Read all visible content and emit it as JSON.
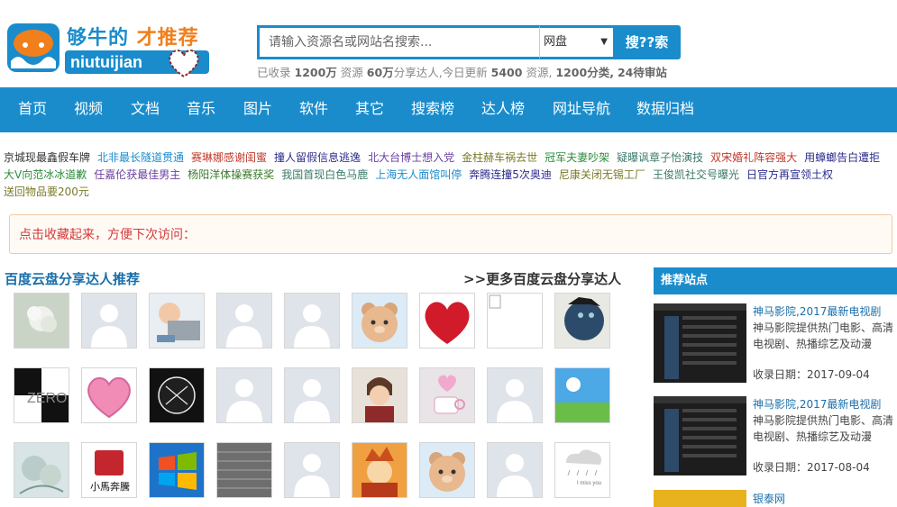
{
  "logo": {
    "title_part1": "够牛的",
    "title_part2": " 才推荐",
    "subtitle": "niutuijian"
  },
  "search": {
    "placeholder": "请输入资源名或网站名搜索...",
    "select_value": "网盘",
    "button_label": "搜??索"
  },
  "stats": {
    "prefix": "已收录",
    "resources": "1200万",
    "resources_unit": "资源",
    "sharers": "60万",
    "sharers_unit": "分享达人,今日更新",
    "today": "5400",
    "today_unit": "资源,",
    "categories": "1200分类,",
    "pending": "24待审站"
  },
  "nav": {
    "items": [
      "首页",
      "视频",
      "文档",
      "音乐",
      "图片",
      "软件",
      "其它",
      "搜索榜",
      "达人榜",
      "网址导航",
      "数据归档"
    ]
  },
  "news": {
    "items": [
      {
        "text": "京城现最鑫假车牌",
        "color": "#333333"
      },
      {
        "text": "北非最长隧道贯通",
        "color": "#1a8ccc"
      },
      {
        "text": "赛琳娜感谢闺蜜",
        "color": "#c0392b"
      },
      {
        "text": "撞人留假信息逃逸",
        "color": "#2c2c8c"
      },
      {
        "text": "北大台博士想入党",
        "color": "#6b3fa0"
      },
      {
        "text": "金柱赫车祸去世",
        "color": "#7a7a2a"
      },
      {
        "text": "冠军夫妻吵架",
        "color": "#2c8c3c"
      },
      {
        "text": "疑曝讽章子怡演技",
        "color": "#3a7a6a"
      },
      {
        "text": "双宋婚礼阵容强大",
        "color": "#c0392b"
      },
      {
        "text": "用蟑螂告白遭拒",
        "color": "#2c2c8c"
      },
      {
        "text": "大V向范冰冰道歉",
        "color": "#2c8c3c"
      },
      {
        "text": "任嘉伦获最佳男主",
        "color": "#6b3fa0"
      },
      {
        "text": "杨阳洋体操赛获奖",
        "color": "#3a7a2a"
      },
      {
        "text": "我国首现白色马鹿",
        "color": "#3a7a6a"
      },
      {
        "text": "上海无人面馆叫停",
        "color": "#1a8ccc"
      },
      {
        "text": "奔腾连撞5次奥迪",
        "color": "#2c2c8c"
      },
      {
        "text": "尼康关闭无锡工厂",
        "color": "#7a7a2a"
      },
      {
        "text": "王俊凯社交号曝光",
        "color": "#3a7a6a"
      },
      {
        "text": "日官方再宣领土权",
        "color": "#2c2c8c"
      },
      {
        "text": "送回物品要200元",
        "color": "#7a7a2a"
      }
    ]
  },
  "notice": {
    "text": "点击收藏起来，方便下次访问："
  },
  "section": {
    "title": "百度云盘分享达人推荐",
    "more": ">>更多百度云盘分享达人"
  },
  "avatars": [
    "flower-photo",
    "default-avatar",
    "baby-photo",
    "default-avatar",
    "default-avatar",
    "bear-cartoon",
    "heart-roses",
    "broken-image",
    "face-art",
    "zero-art",
    "pink-heart",
    "basketball-art",
    "default-avatar",
    "default-avatar",
    "boy-photo",
    "heart-cup",
    "default-avatar",
    "sky-photo",
    "watercolor-art",
    "horse-logo",
    "windows-logo",
    "pattern-photo",
    "default-avatar",
    "anime-art",
    "bear-cartoon",
    "default-avatar",
    "rain-sketch"
  ],
  "sidebar": {
    "heading": "推荐站点",
    "items": [
      {
        "title": "神马影院,2017最新电视剧",
        "desc": "神马影院提供热门电影、高清电视剧、热播综艺及动漫",
        "date": "收录日期：2017-09-04"
      },
      {
        "title": "神马影院,2017最新电视剧",
        "desc": "神马影院提供热门电影、高清电视剧、热播综艺及动漫",
        "date": "收录日期：2017-08-04"
      }
    ],
    "last_title": "银泰网"
  },
  "colors": {
    "brand": "#1a8ccc",
    "accent": "#f07f1c",
    "notice": "#d23a3a"
  }
}
